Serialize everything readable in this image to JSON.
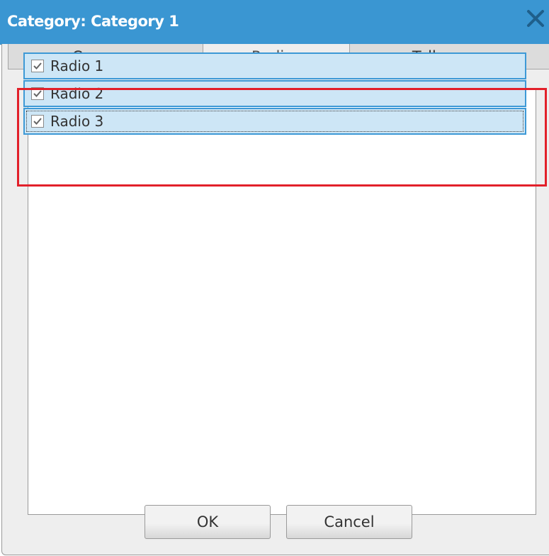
{
  "window": {
    "title": "Category: Category 1",
    "close_icon": "close-icon"
  },
  "tabs": [
    {
      "label": "Common",
      "active": false
    },
    {
      "label": "Radios",
      "active": true
    },
    {
      "label": "Talkgroups",
      "active": false
    }
  ],
  "radios": {
    "items": [
      {
        "label": "Radio 1",
        "checked": true
      },
      {
        "label": "Radio 2",
        "checked": true
      },
      {
        "label": "Radio 3",
        "checked": true,
        "focused": true
      }
    ]
  },
  "buttons": {
    "ok_label": "OK",
    "cancel_label": "Cancel"
  },
  "colors": {
    "titlebar": "#3a96d2",
    "selection": "#cde6f6",
    "selection_border": "#3d99d6",
    "highlight_frame": "#e2202a"
  }
}
